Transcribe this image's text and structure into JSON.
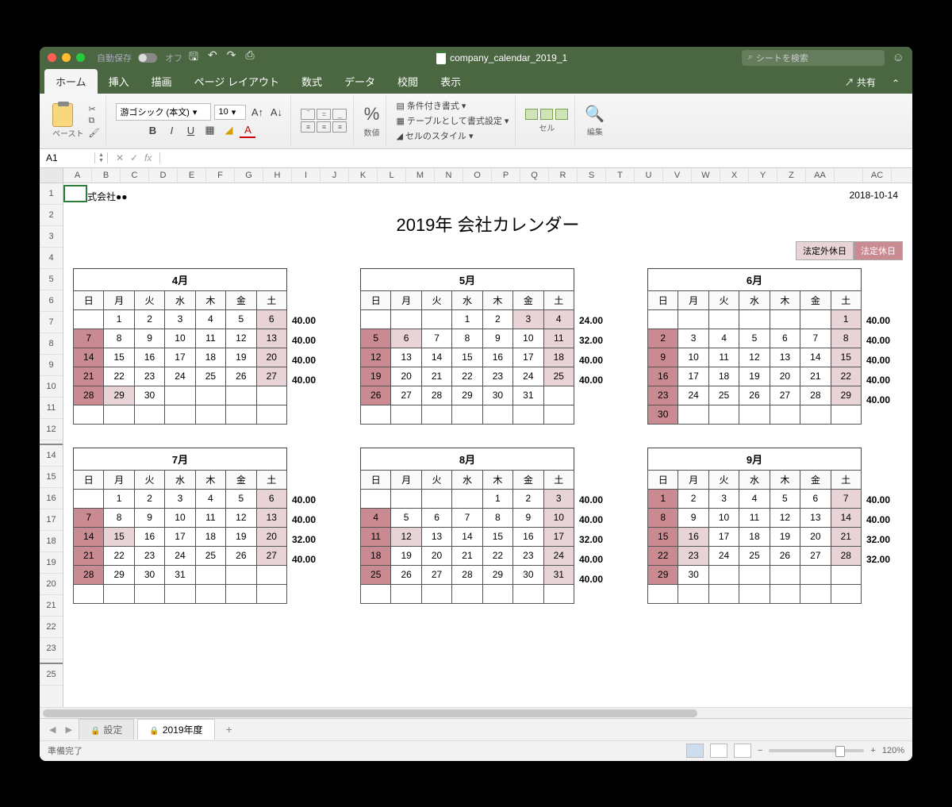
{
  "titlebar": {
    "autosave": "自動保存",
    "toggle_state": "オフ",
    "filename": "company_calendar_2019_1",
    "search_placeholder": "シートを検索"
  },
  "ribbon_tabs": [
    "ホーム",
    "挿入",
    "描画",
    "ページ レイアウト",
    "数式",
    "データ",
    "校閲",
    "表示"
  ],
  "share_label": "共有",
  "ribbon": {
    "paste": "ペースト",
    "font_name": "游ゴシック (本文)",
    "font_size": "10",
    "number_label": "数値",
    "cond_fmt": "条件付き書式",
    "table_fmt": "テーブルとして書式設定",
    "cell_style": "セルのスタイル",
    "cells_label": "セル",
    "edit_label": "編集"
  },
  "namebox": "A1",
  "fx_label": "fx",
  "columns": [
    "A",
    "B",
    "C",
    "D",
    "E",
    "F",
    "G",
    "H",
    "I",
    "J",
    "K",
    "L",
    "M",
    "N",
    "O",
    "P",
    "Q",
    "R",
    "S",
    "T",
    "U",
    "V",
    "W",
    "X",
    "Y",
    "Z",
    "AA",
    "",
    "AC"
  ],
  "rows": [
    "1",
    "2",
    "3",
    "4",
    "5",
    "6",
    "7",
    "8",
    "9",
    "10",
    "11",
    "12",
    "",
    "14",
    "15",
    "16",
    "17",
    "18",
    "19",
    "20",
    "21",
    "22",
    "23",
    "",
    "25"
  ],
  "doc": {
    "company": "株式会社●●",
    "date": "2018-10-14",
    "title": "2019年 会社カレンダー",
    "legend_a": "法定外休日",
    "legend_b": "法定休日"
  },
  "weekday_labels": [
    "日",
    "月",
    "火",
    "水",
    "木",
    "金",
    "土"
  ],
  "months": [
    {
      "name": "4月",
      "weeks": [
        {
          "days": [
            null,
            {
              "n": 1
            },
            {
              "n": 2
            },
            {
              "n": 3
            },
            {
              "n": 4
            },
            {
              "n": 5
            },
            {
              "n": 6,
              "c": "l"
            }
          ],
          "h": "40.00"
        },
        {
          "days": [
            {
              "n": 7,
              "c": "d"
            },
            {
              "n": 8
            },
            {
              "n": 9
            },
            {
              "n": 10
            },
            {
              "n": 11
            },
            {
              "n": 12
            },
            {
              "n": 13,
              "c": "l"
            }
          ],
          "h": "40.00"
        },
        {
          "days": [
            {
              "n": 14,
              "c": "d"
            },
            {
              "n": 15
            },
            {
              "n": 16
            },
            {
              "n": 17
            },
            {
              "n": 18
            },
            {
              "n": 19
            },
            {
              "n": 20,
              "c": "l"
            }
          ],
          "h": "40.00"
        },
        {
          "days": [
            {
              "n": 21,
              "c": "d"
            },
            {
              "n": 22
            },
            {
              "n": 23
            },
            {
              "n": 24
            },
            {
              "n": 25
            },
            {
              "n": 26
            },
            {
              "n": 27,
              "c": "l"
            }
          ],
          "h": "40.00"
        },
        {
          "days": [
            {
              "n": 28,
              "c": "d"
            },
            {
              "n": 29,
              "c": "l"
            },
            {
              "n": 30
            },
            null,
            null,
            null,
            null
          ],
          "h": ""
        },
        {
          "days": [
            null,
            null,
            null,
            null,
            null,
            null,
            null
          ],
          "h": ""
        }
      ]
    },
    {
      "name": "5月",
      "weeks": [
        {
          "days": [
            null,
            null,
            null,
            {
              "n": 1
            },
            {
              "n": 2
            },
            {
              "n": 3,
              "c": "l"
            },
            {
              "n": 4,
              "c": "l"
            }
          ],
          "h": "24.00"
        },
        {
          "days": [
            {
              "n": 5,
              "c": "d"
            },
            {
              "n": 6,
              "c": "l"
            },
            {
              "n": 7
            },
            {
              "n": 8
            },
            {
              "n": 9
            },
            {
              "n": 10
            },
            {
              "n": 11,
              "c": "l"
            }
          ],
          "h": "32.00"
        },
        {
          "days": [
            {
              "n": 12,
              "c": "d"
            },
            {
              "n": 13
            },
            {
              "n": 14
            },
            {
              "n": 15
            },
            {
              "n": 16
            },
            {
              "n": 17
            },
            {
              "n": 18,
              "c": "l"
            }
          ],
          "h": "40.00"
        },
        {
          "days": [
            {
              "n": 19,
              "c": "d"
            },
            {
              "n": 20
            },
            {
              "n": 21
            },
            {
              "n": 22
            },
            {
              "n": 23
            },
            {
              "n": 24
            },
            {
              "n": 25,
              "c": "l"
            }
          ],
          "h": "40.00"
        },
        {
          "days": [
            {
              "n": 26,
              "c": "d"
            },
            {
              "n": 27
            },
            {
              "n": 28
            },
            {
              "n": 29
            },
            {
              "n": 30
            },
            {
              "n": 31
            },
            null
          ],
          "h": ""
        },
        {
          "days": [
            null,
            null,
            null,
            null,
            null,
            null,
            null
          ],
          "h": ""
        }
      ]
    },
    {
      "name": "6月",
      "weeks": [
        {
          "days": [
            null,
            null,
            null,
            null,
            null,
            null,
            {
              "n": 1,
              "c": "l"
            }
          ],
          "h": "40.00"
        },
        {
          "days": [
            {
              "n": 2,
              "c": "d"
            },
            {
              "n": 3
            },
            {
              "n": 4
            },
            {
              "n": 5
            },
            {
              "n": 6
            },
            {
              "n": 7
            },
            {
              "n": 8,
              "c": "l"
            }
          ],
          "h": "40.00"
        },
        {
          "days": [
            {
              "n": 9,
              "c": "d"
            },
            {
              "n": 10
            },
            {
              "n": 11
            },
            {
              "n": 12
            },
            {
              "n": 13
            },
            {
              "n": 14
            },
            {
              "n": 15,
              "c": "l"
            }
          ],
          "h": "40.00"
        },
        {
          "days": [
            {
              "n": 16,
              "c": "d"
            },
            {
              "n": 17
            },
            {
              "n": 18
            },
            {
              "n": 19
            },
            {
              "n": 20
            },
            {
              "n": 21
            },
            {
              "n": 22,
              "c": "l"
            }
          ],
          "h": "40.00"
        },
        {
          "days": [
            {
              "n": 23,
              "c": "d"
            },
            {
              "n": 24
            },
            {
              "n": 25
            },
            {
              "n": 26
            },
            {
              "n": 27
            },
            {
              "n": 28
            },
            {
              "n": 29,
              "c": "l"
            }
          ],
          "h": "40.00"
        },
        {
          "days": [
            {
              "n": 30,
              "c": "d"
            },
            null,
            null,
            null,
            null,
            null,
            null
          ],
          "h": ""
        }
      ]
    },
    {
      "name": "7月",
      "weeks": [
        {
          "days": [
            null,
            {
              "n": 1
            },
            {
              "n": 2
            },
            {
              "n": 3
            },
            {
              "n": 4
            },
            {
              "n": 5
            },
            {
              "n": 6,
              "c": "l"
            }
          ],
          "h": "40.00"
        },
        {
          "days": [
            {
              "n": 7,
              "c": "d"
            },
            {
              "n": 8
            },
            {
              "n": 9
            },
            {
              "n": 10
            },
            {
              "n": 11
            },
            {
              "n": 12
            },
            {
              "n": 13,
              "c": "l"
            }
          ],
          "h": "40.00"
        },
        {
          "days": [
            {
              "n": 14,
              "c": "d"
            },
            {
              "n": 15,
              "c": "l"
            },
            {
              "n": 16
            },
            {
              "n": 17
            },
            {
              "n": 18
            },
            {
              "n": 19
            },
            {
              "n": 20,
              "c": "l"
            }
          ],
          "h": "32.00"
        },
        {
          "days": [
            {
              "n": 21,
              "c": "d"
            },
            {
              "n": 22
            },
            {
              "n": 23
            },
            {
              "n": 24
            },
            {
              "n": 25
            },
            {
              "n": 26
            },
            {
              "n": 27,
              "c": "l"
            }
          ],
          "h": "40.00"
        },
        {
          "days": [
            {
              "n": 28,
              "c": "d"
            },
            {
              "n": 29
            },
            {
              "n": 30
            },
            {
              "n": 31
            },
            null,
            null,
            null
          ],
          "h": ""
        },
        {
          "days": [
            null,
            null,
            null,
            null,
            null,
            null,
            null
          ],
          "h": ""
        }
      ]
    },
    {
      "name": "8月",
      "weeks": [
        {
          "days": [
            null,
            null,
            null,
            null,
            {
              "n": 1
            },
            {
              "n": 2
            },
            {
              "n": 3,
              "c": "l"
            }
          ],
          "h": "40.00"
        },
        {
          "days": [
            {
              "n": 4,
              "c": "d"
            },
            {
              "n": 5
            },
            {
              "n": 6
            },
            {
              "n": 7
            },
            {
              "n": 8
            },
            {
              "n": 9
            },
            {
              "n": 10,
              "c": "l"
            }
          ],
          "h": "40.00"
        },
        {
          "days": [
            {
              "n": 11,
              "c": "d"
            },
            {
              "n": 12,
              "c": "l"
            },
            {
              "n": 13
            },
            {
              "n": 14
            },
            {
              "n": 15
            },
            {
              "n": 16
            },
            {
              "n": 17,
              "c": "l"
            }
          ],
          "h": "32.00"
        },
        {
          "days": [
            {
              "n": 18,
              "c": "d"
            },
            {
              "n": 19
            },
            {
              "n": 20
            },
            {
              "n": 21
            },
            {
              "n": 22
            },
            {
              "n": 23
            },
            {
              "n": 24,
              "c": "l"
            }
          ],
          "h": "40.00"
        },
        {
          "days": [
            {
              "n": 25,
              "c": "d"
            },
            {
              "n": 26
            },
            {
              "n": 27
            },
            {
              "n": 28
            },
            {
              "n": 29
            },
            {
              "n": 30
            },
            {
              "n": 31,
              "c": "l"
            }
          ],
          "h": "40.00"
        },
        {
          "days": [
            null,
            null,
            null,
            null,
            null,
            null,
            null
          ],
          "h": ""
        }
      ]
    },
    {
      "name": "9月",
      "weeks": [
        {
          "days": [
            {
              "n": 1,
              "c": "d"
            },
            {
              "n": 2
            },
            {
              "n": 3
            },
            {
              "n": 4
            },
            {
              "n": 5
            },
            {
              "n": 6
            },
            {
              "n": 7,
              "c": "l"
            }
          ],
          "h": "40.00"
        },
        {
          "days": [
            {
              "n": 8,
              "c": "d"
            },
            {
              "n": 9
            },
            {
              "n": 10
            },
            {
              "n": 11
            },
            {
              "n": 12
            },
            {
              "n": 13
            },
            {
              "n": 14,
              "c": "l"
            }
          ],
          "h": "40.00"
        },
        {
          "days": [
            {
              "n": 15,
              "c": "d"
            },
            {
              "n": 16,
              "c": "l"
            },
            {
              "n": 17
            },
            {
              "n": 18
            },
            {
              "n": 19
            },
            {
              "n": 20
            },
            {
              "n": 21,
              "c": "l"
            }
          ],
          "h": "32.00"
        },
        {
          "days": [
            {
              "n": 22,
              "c": "d"
            },
            {
              "n": 23,
              "c": "l"
            },
            {
              "n": 24
            },
            {
              "n": 25
            },
            {
              "n": 26
            },
            {
              "n": 27
            },
            {
              "n": 28,
              "c": "l"
            }
          ],
          "h": "32.00"
        },
        {
          "days": [
            {
              "n": 29,
              "c": "d"
            },
            {
              "n": 30
            },
            null,
            null,
            null,
            null,
            null
          ],
          "h": ""
        },
        {
          "days": [
            null,
            null,
            null,
            null,
            null,
            null,
            null
          ],
          "h": ""
        }
      ]
    }
  ],
  "sheet_tabs": {
    "tab1": "設定",
    "tab2": "2019年度"
  },
  "status": {
    "ready": "準備完了",
    "zoom": "120%"
  }
}
